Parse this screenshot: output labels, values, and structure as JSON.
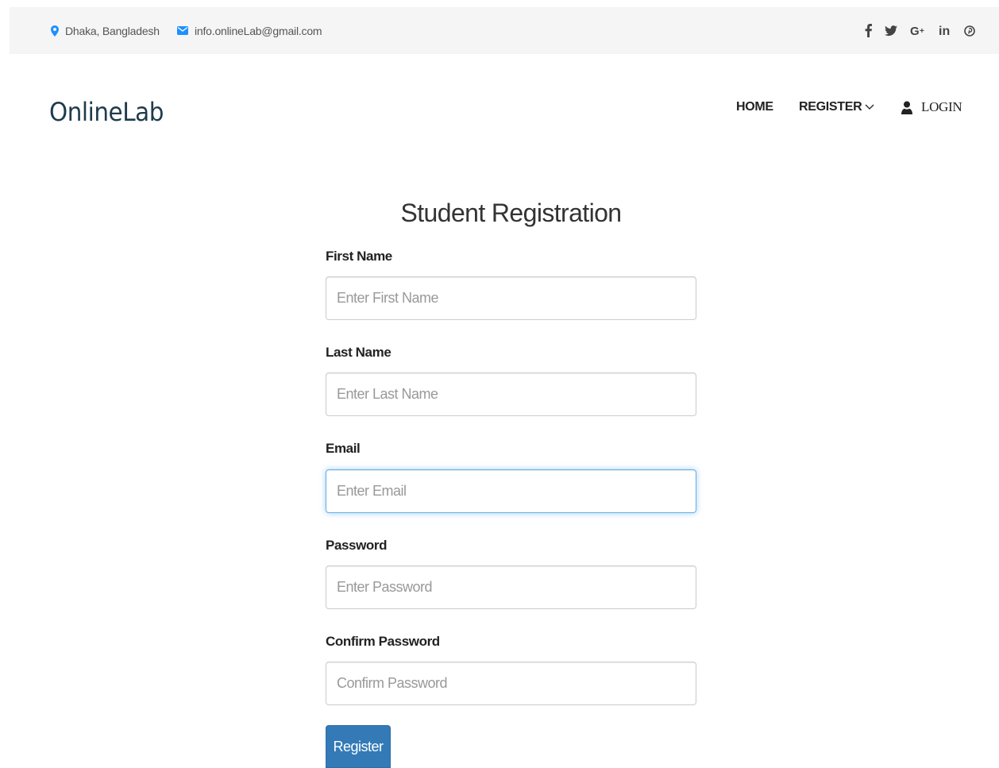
{
  "topbar": {
    "location": "Dhaka, Bangladesh",
    "email": "info.onlineLab@gmail.com",
    "social": [
      {
        "icon": "facebook-icon",
        "glyph": "f"
      },
      {
        "icon": "twitter-icon",
        "glyph": "🐦"
      },
      {
        "icon": "google-plus-icon",
        "glyph": "G+"
      },
      {
        "icon": "linkedin-icon",
        "glyph": "in"
      },
      {
        "icon": "pinterest-icon",
        "glyph": "℗"
      }
    ]
  },
  "header": {
    "logo": "OnlineLab",
    "nav": {
      "home": "HOME",
      "register": "REGISTER",
      "login": "LOGIN"
    }
  },
  "form": {
    "title": "Student Registration",
    "fields": [
      {
        "label": "First Name",
        "placeholder": "Enter First Name",
        "value": ""
      },
      {
        "label": "Last Name",
        "placeholder": "Enter Last Name",
        "value": ""
      },
      {
        "label": "Email",
        "placeholder": "Enter Email",
        "value": ""
      },
      {
        "label": "Password",
        "placeholder": "Enter Password",
        "value": ""
      },
      {
        "label": "Confirm Password",
        "placeholder": "Confirm Password",
        "value": ""
      }
    ],
    "submit_label": "Register"
  },
  "colors": {
    "accent": "#337ab7",
    "focus": "#66afe9",
    "icon_blue": "#1e90ff",
    "logo": "#1f3b4d"
  }
}
